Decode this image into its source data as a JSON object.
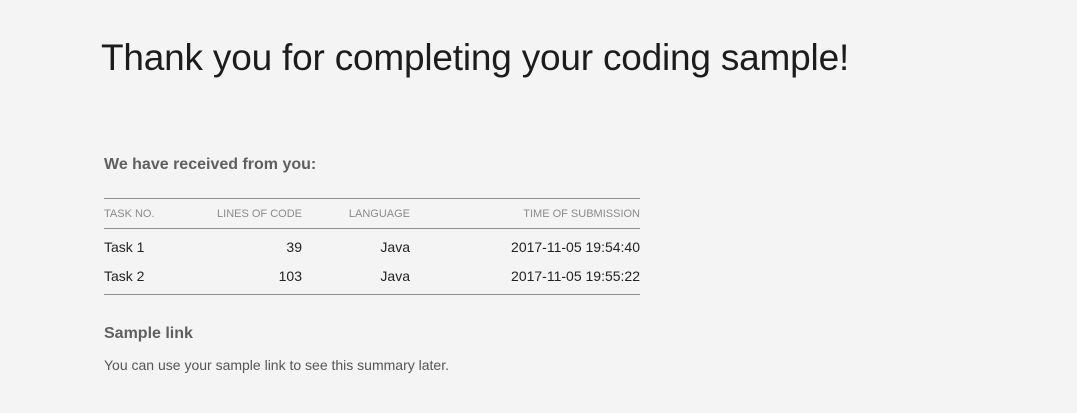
{
  "page": {
    "title": "Thank you for completing your coding sample!"
  },
  "received": {
    "heading": "We have received from you:",
    "columns": {
      "task": "TASK NO.",
      "lines": "LINES OF CODE",
      "language": "LANGUAGE",
      "time": "TIME OF SUBMISSION"
    },
    "rows": [
      {
        "task": "Task 1",
        "lines": "39",
        "language": "Java",
        "time": "2017-11-05 19:54:40"
      },
      {
        "task": "Task 2",
        "lines": "103",
        "language": "Java",
        "time": "2017-11-05 19:55:22"
      }
    ]
  },
  "sample_link": {
    "heading": "Sample link",
    "text": "You can use your sample link to see this summary later."
  }
}
